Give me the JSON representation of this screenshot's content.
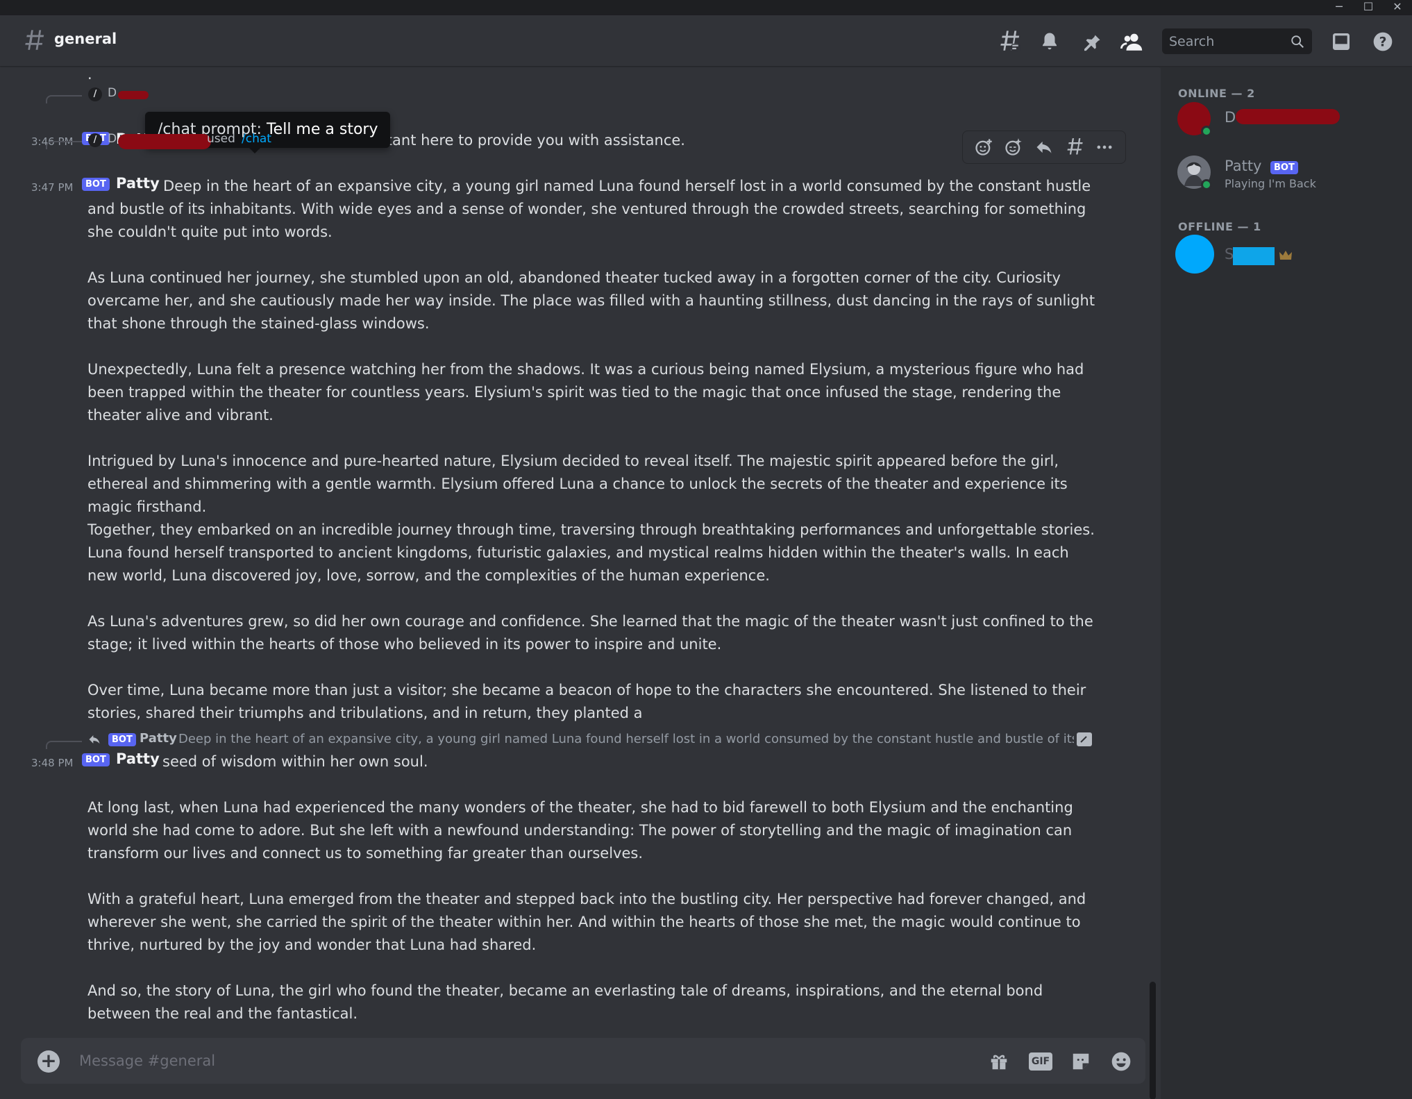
{
  "window": {
    "min": "─",
    "max": "☐",
    "close": "✕"
  },
  "header": {
    "channel_name": "general",
    "search_placeholder": "Search"
  },
  "messages": {
    "m0_dot": ".",
    "m1": {
      "slash_user_initial": "D",
      "time": "3:46 PM",
      "bot": "BOT",
      "author": "Patt",
      "text_tail": "istant here to provide you with assistance."
    },
    "tooltip": {
      "label": "/chat prompt: ",
      "value": "Tell me a story"
    },
    "m2": {
      "slash_user_initial": "D",
      "used": "used",
      "command": "/chat",
      "time": "3:47 PM",
      "bot": "BOT",
      "author": "Patty",
      "p1": "Deep in the heart of an expansive city, a young girl named Luna found herself lost in a world consumed by the constant hustle and bustle of its inhabitants. With wide eyes and a sense of wonder, she ventured through the crowded streets, searching for something she couldn't quite put into words.",
      "p2": "As Luna continued her journey, she stumbled upon an old, abandoned theater tucked away in a forgotten corner of the city. Curiosity overcame her, and she cautiously made her way inside. The place was filled with a haunting stillness, dust dancing in the rays of sunlight that shone through the stained-glass windows.",
      "p3": "Unexpectedly, Luna felt a presence watching her from the shadows. It was a curious being named Elysium, a mysterious figure who had been trapped within the theater for countless years. Elysium's spirit was tied to the magic that once infused the stage, rendering the theater alive and vibrant.",
      "p4": "Intrigued by Luna's innocence and pure-hearted nature, Elysium decided to reveal itself. The majestic spirit appeared before the girl, ethereal and shimmering with a gentle warmth. Elysium offered Luna a chance to unlock the secrets of the theater and experience its magic firsthand.",
      "p5": "Together, they embarked on an incredible journey through time, traversing through breathtaking performances and unforgettable stories. Luna found herself transported to ancient kingdoms, futuristic galaxies, and mystical realms hidden within the theater's walls. In each new world, Luna discovered joy, love, sorrow, and the complexities of the human experience.",
      "p6": "As Luna's adventures grew, so did her own courage and confidence. She learned that the magic of the theater wasn't just confined to the stage; it lived within the hearts of those who believed in its power to inspire and unite.",
      "p7": "Over time, Luna became more than just a visitor; she became a beacon of hope to the characters she encountered. She listened to their stories, shared their triumphs and tribulations, and in return, they planted a"
    },
    "m3": {
      "reply_bot": "BOT",
      "reply_author": "Patty",
      "reply_preview": "Deep in the heart of an expansive city, a young girl named Luna found herself lost in a world consumed by the constant hustle and bustle of its i...",
      "time": "3:48 PM",
      "bot": "BOT",
      "author": "Patty",
      "p1": "seed of wisdom within her own soul.",
      "p2": "At long last, when Luna had experienced the many wonders of the theater, she had to bid farewell to both Elysium and the enchanting world she had come to adore. But she left with a newfound understanding: The power of storytelling and the magic of imagination can transform our lives and connect us to something far greater than ourselves.",
      "p3": "With a grateful heart, Luna emerged from the theater and stepped back into the bustling city. Her perspective had forever changed, and wherever she went, she carried the spirit of the theater within her. And within the hearts of those she met, the magic would continue to thrive, nurtured by the joy and wonder that Luna had shared.",
      "p4": "And so, the story of Luna, the girl who found the theater, became an everlasting tale of dreams, inspirations, and the eternal bond between the real and the fantastical."
    }
  },
  "composer": {
    "placeholder": "Message #general",
    "gif_label": "GIF",
    "add": "+"
  },
  "members": {
    "online_header": "ONLINE — 2",
    "offline_header": "OFFLINE — 1",
    "online": [
      {
        "name": "D"
      },
      {
        "name": "Patty",
        "badge": "BOT",
        "activity": "Playing I'm Back"
      }
    ],
    "offline": [
      {
        "name": "S"
      }
    ]
  },
  "colors": {
    "blurple": "#5865f2",
    "online_green": "#23a55a",
    "redaction_red": "#8b0a14",
    "redaction_blue": "#0ea5e9"
  }
}
